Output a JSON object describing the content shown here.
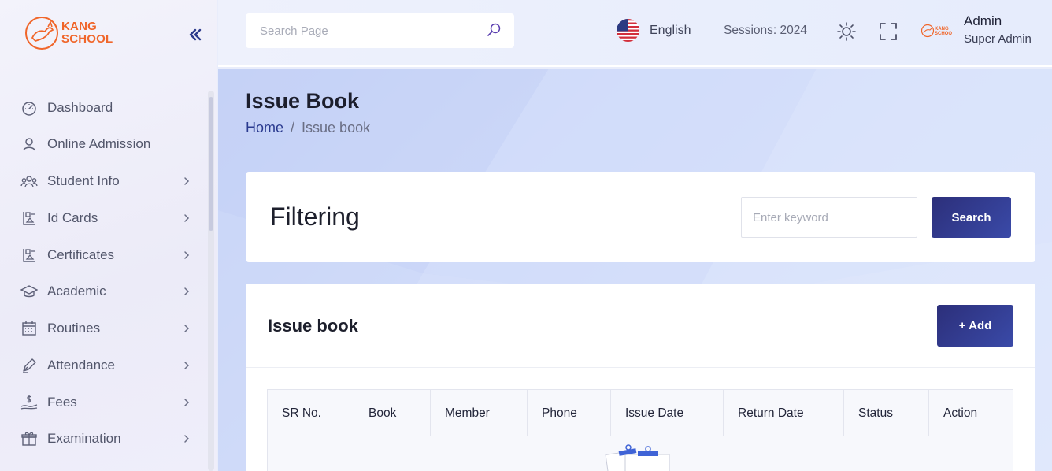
{
  "brand": {
    "logo_line1": "KANG",
    "logo_line2": "SCHOOL",
    "accent": "#f0662a",
    "primary": "#2c3a8c"
  },
  "sidebar": {
    "collapse_icon": "double-chevron-left-icon",
    "items": [
      {
        "label": "Dashboard",
        "icon": "speedometer-icon",
        "has_children": false
      },
      {
        "label": "Online Admission",
        "icon": "user-icon",
        "has_children": false
      },
      {
        "label": "Student Info",
        "icon": "users-group-icon",
        "has_children": true
      },
      {
        "label": "Id Cards",
        "icon": "id-card-icon",
        "has_children": true
      },
      {
        "label": "Certificates",
        "icon": "certificate-icon",
        "has_children": true
      },
      {
        "label": "Academic",
        "icon": "graduation-cap-icon",
        "has_children": true
      },
      {
        "label": "Routines",
        "icon": "calendar-icon",
        "has_children": true
      },
      {
        "label": "Attendance",
        "icon": "pen-icon",
        "has_children": true
      },
      {
        "label": "Fees",
        "icon": "money-hand-icon",
        "has_children": true
      },
      {
        "label": "Examination",
        "icon": "gift-box-icon",
        "has_children": true
      }
    ]
  },
  "header": {
    "search_placeholder": "Search Page",
    "language": "English",
    "session": "Sessions: 2024",
    "user_name": "Admin",
    "user_role": "Super Admin"
  },
  "page": {
    "title": "Issue Book",
    "breadcrumb_home": "Home",
    "breadcrumb_sep": "/",
    "breadcrumb_current": "Issue book"
  },
  "filter": {
    "title": "Filtering",
    "keyword_placeholder": "Enter keyword",
    "search_label": "Search"
  },
  "list": {
    "title": "Issue book",
    "add_label": "+ Add",
    "columns": [
      "SR No.",
      "Book",
      "Member",
      "Phone",
      "Issue Date",
      "Return Date",
      "Status",
      "Action"
    ]
  }
}
